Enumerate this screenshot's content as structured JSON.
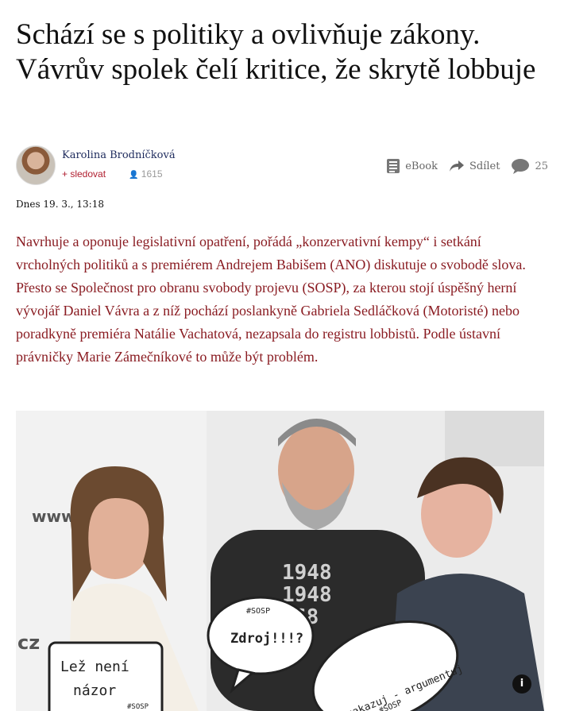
{
  "article": {
    "title": "Schází se s politiky a ovlivňuje zákony. Vávrův spolek čelí kritice, že skrytě lobbuje",
    "author": {
      "name": "Karolina Brodníčková",
      "follow_label": "+ sledovat",
      "followers": "1615"
    },
    "actions": {
      "ebook_label": "eBook",
      "share_label": "Sdílet",
      "comments_count": "25"
    },
    "date": "Dnes 19. 3., 13:18",
    "lead": "Navrhuje a oponuje legislativní opatření, pořádá „konzervativní kempy“ i setkání vrcholných politiků a s premiérem Andrejem Babišem (ANO) diskutuje o svobodě slova. Přesto se Společnost pro obranu svobody projevu (SOSP), za kterou stojí úspěšný herní vývojář Daniel Vávra a z níž pochází poslankyně Gabriela Sedláčková (Motoristé) nebo poradkyně premiéra Natálie Vachatová, nezapsala do registru lobbistů. Podle ústavní právničky Marie Zámečníkové to může být problém."
  },
  "photo": {
    "backdrop_text_url": "www.s",
    "backdrop_text_cz": "cz",
    "sign_left_line1": "Lež není",
    "sign_left_line2": "názor",
    "sign_left_tag": "#SOSP",
    "bubble_tag": "#SOSP",
    "bubble_text": "Zdroj!!!?",
    "oval_text": "Nezakazuj - argumentuj",
    "oval_tag": "#SOSP",
    "shirt_years": [
      "1948",
      "1948",
      "68"
    ],
    "info_label": "i"
  },
  "colors": {
    "lead": "#8a1c22",
    "follow": "#b01e2f",
    "author": "#1d2a5c"
  }
}
